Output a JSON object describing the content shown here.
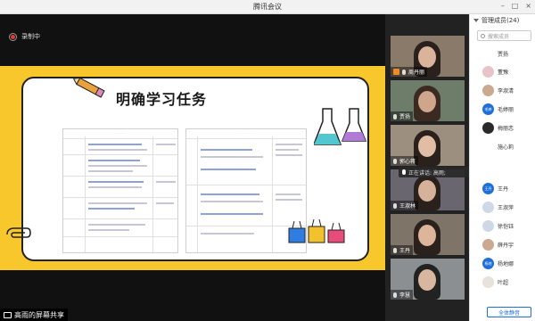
{
  "window": {
    "title": "腾讯会议"
  },
  "recording": {
    "label": "录制中",
    "color": "#e53935"
  },
  "slide": {
    "title": "明确学习任务",
    "background": "#f7c72b"
  },
  "screen_share": {
    "label": "高雨的屏幕共享"
  },
  "video_tiles": [
    {
      "name": "周丹丽",
      "host": true
    },
    {
      "name": "贾扬",
      "host": false
    },
    {
      "name": "郭心蒋",
      "host": false
    },
    {
      "name": "王淑林",
      "host": false
    },
    {
      "name": "王丹",
      "host": false
    },
    {
      "name": "李慧",
      "host": false
    }
  ],
  "speaking": {
    "label": "正在讲话: 高雨;"
  },
  "members_panel": {
    "title": "管理成员(24)",
    "search_placeholder": "搜索成员",
    "members": [
      {
        "name": "贾扬",
        "avatar": "none",
        "initials": ""
      },
      {
        "name": "董豫",
        "avatar": "photo",
        "initials": ""
      },
      {
        "name": "李淑清",
        "avatar": "photo",
        "initials": ""
      },
      {
        "name": "毛婷丽",
        "avatar": "blue",
        "initials": "毛婷"
      },
      {
        "name": "梅丽恋",
        "avatar": "photo",
        "initials": ""
      },
      {
        "name": "施心莉",
        "avatar": "none",
        "initials": ""
      },
      {
        "name": "王丹",
        "avatar": "blue",
        "initials": "王丹"
      },
      {
        "name": "王淑萍",
        "avatar": "light",
        "initials": ""
      },
      {
        "name": "徐恺钰",
        "avatar": "light",
        "initials": ""
      },
      {
        "name": "薛丹宇",
        "avatar": "photo",
        "initials": ""
      },
      {
        "name": "杨地娜",
        "avatar": "blue",
        "initials": "杨地"
      },
      {
        "name": "叶超",
        "avatar": "cup",
        "initials": ""
      }
    ],
    "mute_all_label": "全体静音",
    "accent": "#1e6fd9"
  }
}
